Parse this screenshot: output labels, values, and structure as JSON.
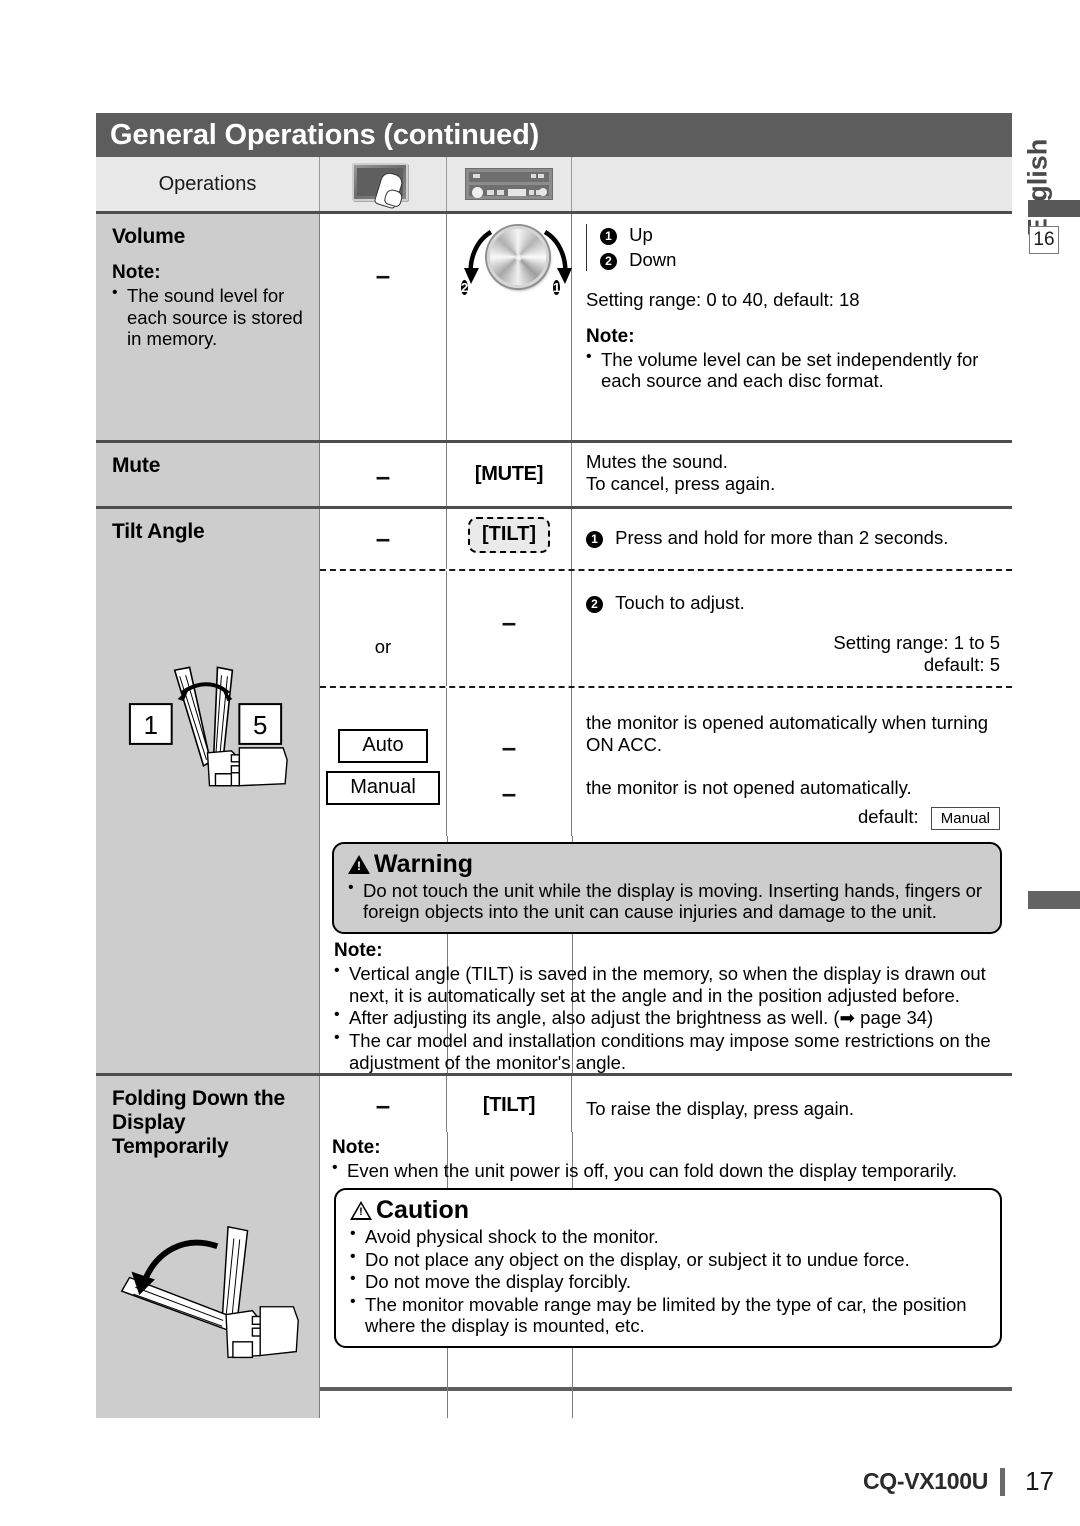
{
  "page": {
    "title": "General Operations (continued)",
    "language_tab": "English",
    "cross_ref_page": "16",
    "footer_model": "CQ-VX100U",
    "footer_page": "17"
  },
  "table": {
    "header": {
      "col_operations": "Operations",
      "icon_touch": "touch-panel-icon",
      "icon_headunit": "head-unit-icon"
    },
    "rows": [
      {
        "name": "Volume",
        "note_head": "Note:",
        "note_items": [
          "The sound level for each source is stored in memory."
        ],
        "col_a": "–",
        "knob_badge_cw": "1",
        "knob_badge_ccw": "2",
        "legend": [
          {
            "badge": "1",
            "text": "Up"
          },
          {
            "badge": "2",
            "text": "Down"
          }
        ],
        "setting_range": "Setting range: 0 to 40, default: 18",
        "desc_note_head": "Note:",
        "desc_note_items": [
          "The volume level can be set independently for each source and each disc format."
        ]
      },
      {
        "name": "Mute",
        "col_a": "–",
        "col_b": "[MUTE]",
        "desc_lines": [
          "Mutes the sound.",
          "To cancel, press again."
        ]
      },
      {
        "name": "Tilt Angle",
        "step1_col_a": "–",
        "step1_col_b": "[TILT]",
        "step1_badge": "1",
        "step1_text": "Press and hold for more than 2 seconds.",
        "step2_col_a": "or",
        "step2_col_b": "–",
        "step2_badge": "2",
        "step2_text": "Touch to adjust.",
        "step2_range_line1": "Setting range: 1 to 5",
        "step2_range_line2": "default: 5",
        "opt_auto_label": "Auto",
        "opt_auto_dash": "–",
        "opt_auto_desc": "the monitor is opened automatically when turning ON ACC.",
        "opt_manual_label": "Manual",
        "opt_manual_dash": "–",
        "opt_manual_desc": "the monitor is not opened automatically.",
        "default_label": "default:",
        "default_value": "Manual",
        "warning_title": "Warning",
        "warning_items": [
          "Do not touch the unit while the display is moving. Inserting hands, fingers or foreign objects into the unit can cause injuries and damage to the unit."
        ],
        "note_head": "Note:",
        "note_items": [
          "Vertical angle (TILT) is saved in the memory, so when the display is drawn out next, it is automatically set at the angle and in the position adjusted before.",
          "After adjusting its angle, also adjust the brightness as well. (➡ page 34)",
          "The car model and installation conditions may impose some restrictions on the adjustment of the monitor's angle."
        ],
        "illustration_label_left": "1",
        "illustration_label_right": "5"
      },
      {
        "name_line1": "Folding Down the",
        "name_line2": "Display Temporarily",
        "col_a": "–",
        "col_b": "[TILT]",
        "desc": "To raise the display, press again.",
        "note_head": "Note:",
        "note_items": [
          "Even when the unit power is off, you can fold down the display temporarily."
        ],
        "caution_title": "Caution",
        "caution_items": [
          "Avoid physical shock to the monitor.",
          "Do not place any object on the display, or subject it to undue force.",
          "Do not move the display forcibly.",
          "The monitor movable range may be limited by the type of car, the position where the display is mounted, etc."
        ]
      }
    ]
  },
  "colors": {
    "title_bar": "#5d5d5d",
    "label_cell": "#cdcdcd",
    "header_cell": "#e8e8e8",
    "warning_bg": "#cdcdcd"
  }
}
